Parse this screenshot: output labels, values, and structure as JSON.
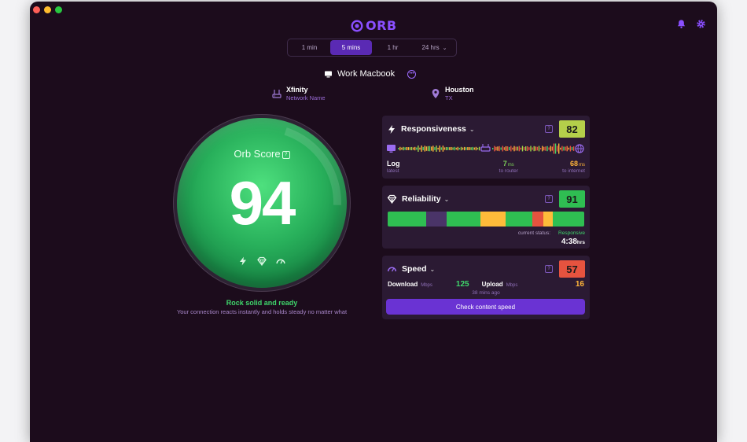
{
  "app": {
    "logo_text": "ORB",
    "brand_color": "#8a4fff"
  },
  "time_ranges": [
    {
      "label": "1 min"
    },
    {
      "label": "5 mins",
      "active": true
    },
    {
      "label": "1 hr"
    },
    {
      "label": "24 hrs"
    }
  ],
  "device": {
    "name": "Work Macbook"
  },
  "network": {
    "name": "Xfinity",
    "sub": "Network Name"
  },
  "location": {
    "city": "Houston",
    "region": "TX"
  },
  "orb": {
    "label": "Orb Score",
    "score": "94",
    "color": "#2fbe62"
  },
  "status": {
    "headline": "Rock solid and ready",
    "detail": "Your connection reacts instantly and holds steady no matter what"
  },
  "responsiveness": {
    "title": "Responsiveness",
    "score": "82",
    "score_color": "#b4cf4a",
    "latest": {
      "value": "Log",
      "label": "latest"
    },
    "router": {
      "value": "7",
      "unit": "ms",
      "label": "to router",
      "color": "#7dd35a"
    },
    "internet": {
      "value": "68",
      "unit": "ms",
      "label": "to internet",
      "color": "#ffb53a"
    }
  },
  "reliability": {
    "title": "Reliability",
    "score": "91",
    "score_color": "#2fbe52",
    "timeline": [
      {
        "state": "good",
        "fraction": 0.195
      },
      {
        "state": "idle",
        "fraction": 0.105
      },
      {
        "state": "good",
        "fraction": 0.17
      },
      {
        "state": "warn",
        "fraction": 0.13
      },
      {
        "state": "good",
        "fraction": 0.135
      },
      {
        "state": "bad",
        "fraction": 0.055
      },
      {
        "state": "warn",
        "fraction": 0.05
      },
      {
        "state": "good",
        "fraction": 0.16
      }
    ],
    "status_label": "current status:",
    "status_value": "Responsive",
    "duration": "4:38",
    "duration_unit": "hrs"
  },
  "speed": {
    "title": "Speed",
    "score": "57",
    "score_color": "#e6533f",
    "download_label": "Download",
    "download_unit": "Mbps",
    "download_value": "125",
    "upload_label": "Upload",
    "upload_unit": "Mbps",
    "upload_value": "16",
    "ago": "38 mins ago",
    "button": "Check content speed"
  }
}
